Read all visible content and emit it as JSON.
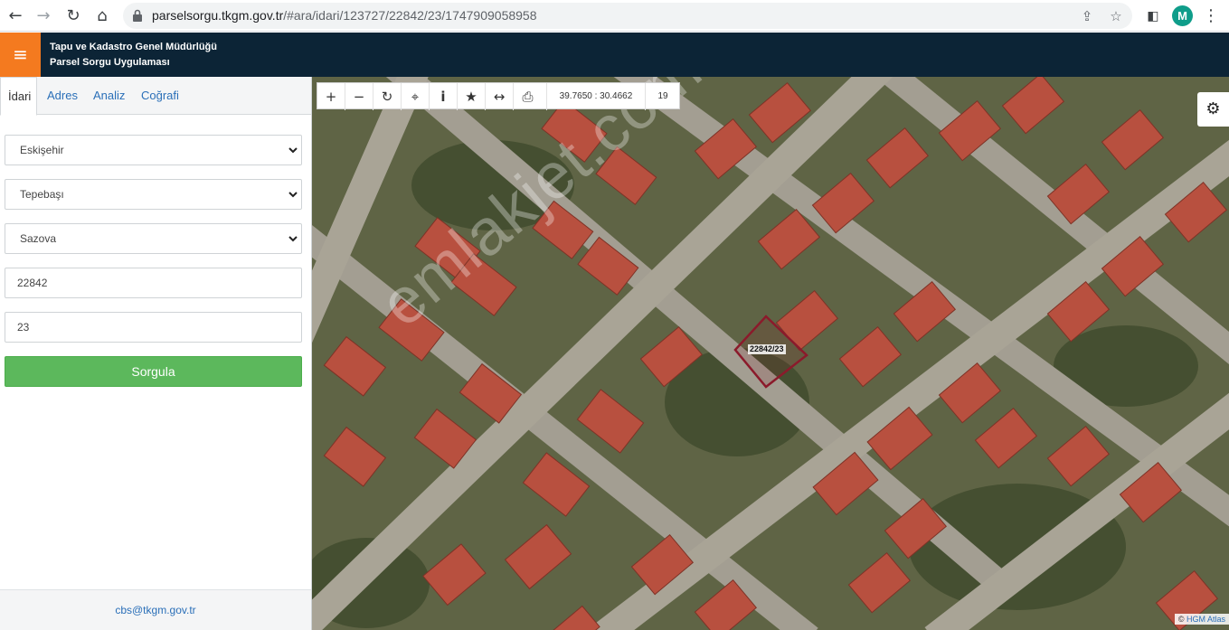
{
  "browser": {
    "url_host": "parselsorgu.tkgm.gov.tr",
    "url_path": "/#ara/idari/123727/22842/23/1747909058958",
    "profile_initial": "M"
  },
  "header": {
    "title_line1": "Tapu ve Kadastro Genel Müdürlüğü",
    "title_line2": "Parsel Sorgu Uygulaması"
  },
  "sidebar": {
    "tabs": [
      {
        "label": "İdari"
      },
      {
        "label": "Adres"
      },
      {
        "label": "Analiz"
      },
      {
        "label": "Coğrafi"
      }
    ],
    "province": "Eskişehir",
    "district": "Tepebaşı",
    "neighborhood": "Sazova",
    "block_no": "22842",
    "parcel_no": "23",
    "query_button": "Sorgula",
    "footer_email": "cbs@tkgm.gov.tr"
  },
  "map": {
    "coordinates": "39.7650 : 30.4662",
    "zoom_level": "19",
    "parcel_label": "22842/23",
    "watermark": "emlakjet.com",
    "attribution_prefix": "©",
    "attribution_link": "HGM Atlas"
  },
  "colors": {
    "header_bg": "#0c2436",
    "menu_accent": "#f47a1f",
    "query_button": "#5cb85c",
    "parcel_outline": "#8b1a2b"
  }
}
